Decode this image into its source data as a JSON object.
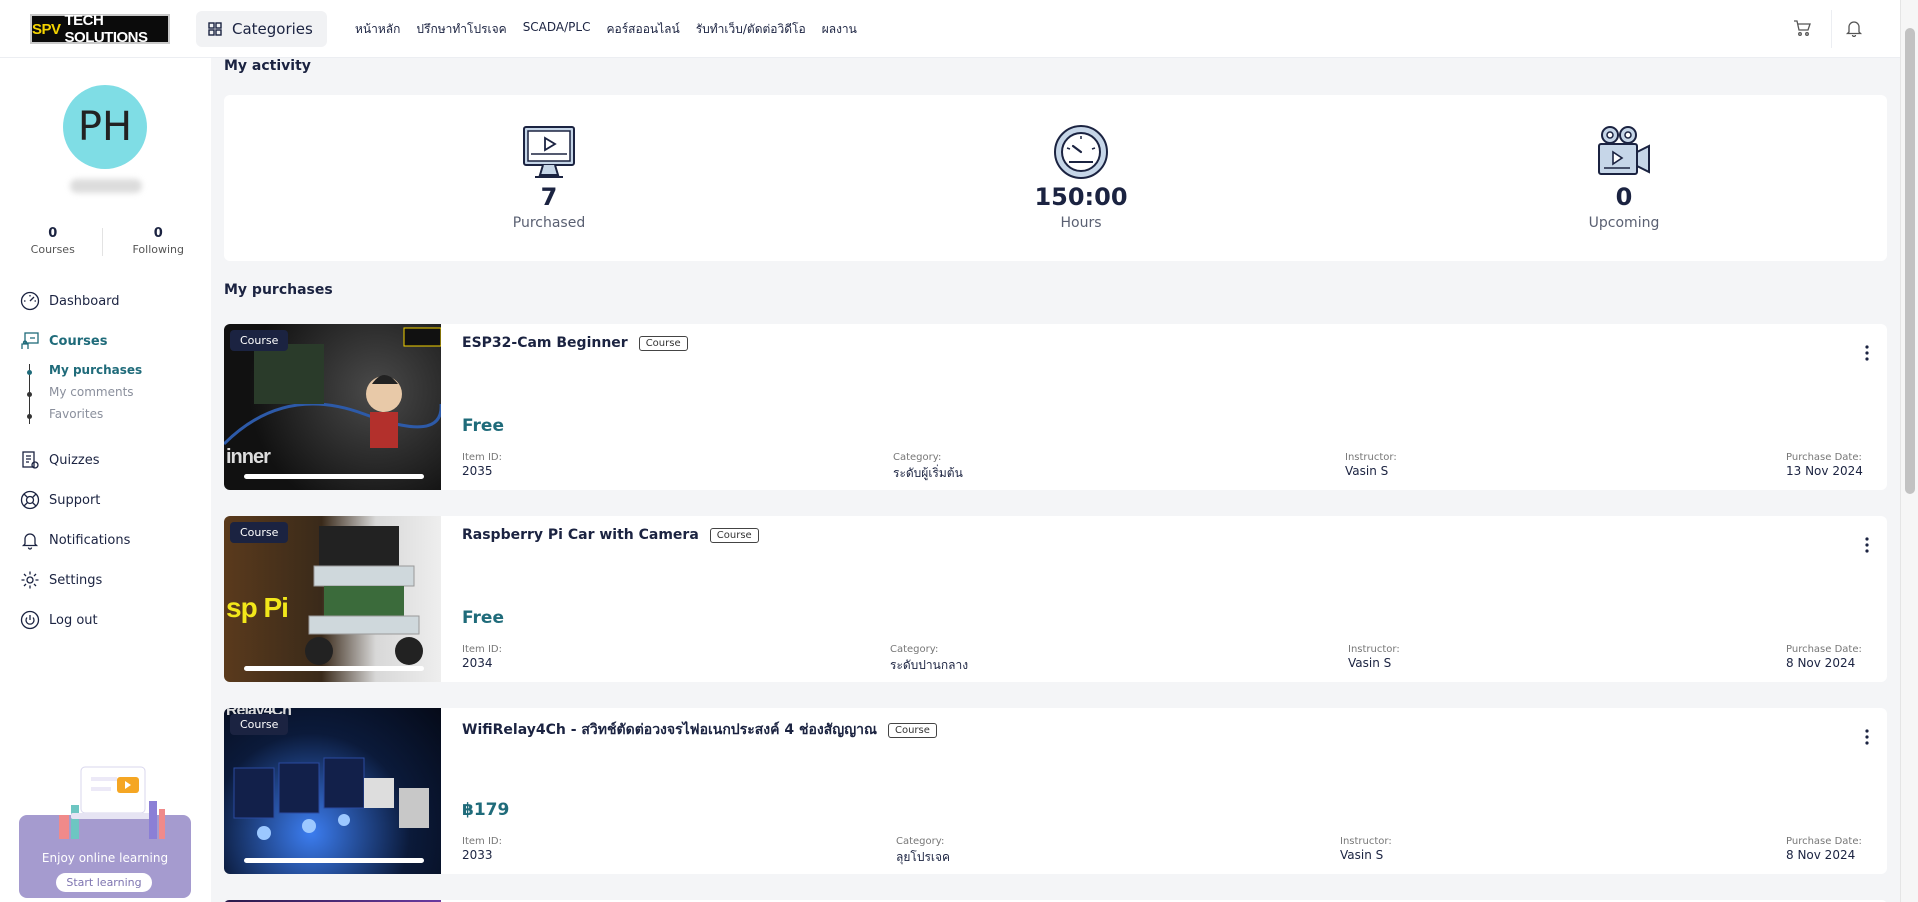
{
  "header": {
    "logo_left": "SPV",
    "logo_right": "TECH SOLUTIONS",
    "categories_label": "Categories",
    "nav": [
      "หน้าหลัก",
      "ปรึกษาทำโปรเจค",
      "SCADA/PLC",
      "คอร์สออนไลน์",
      "รับทำเว็บ/ตัดต่อวิดีโอ",
      "ผลงาน"
    ],
    "cart_icon": "cart-icon",
    "bell_icon": "bell-icon"
  },
  "profile": {
    "initials": "PH",
    "courses_count": "0",
    "courses_label": "Courses",
    "following_count": "0",
    "following_label": "Following"
  },
  "sidebar": {
    "items": [
      {
        "label": "Dashboard",
        "icon": "dashboard-icon"
      },
      {
        "label": "Courses",
        "icon": "courses-icon"
      },
      {
        "label": "Quizzes",
        "icon": "quiz-icon"
      },
      {
        "label": "Support",
        "icon": "support-icon"
      },
      {
        "label": "Notifications",
        "icon": "bell-icon"
      },
      {
        "label": "Settings",
        "icon": "gear-icon"
      },
      {
        "label": "Log out",
        "icon": "power-icon"
      }
    ],
    "sub_items": [
      "My purchases",
      "My comments",
      "Favorites"
    ],
    "promo_text": "Enjoy online learning",
    "promo_button": "Start learning"
  },
  "activity": {
    "title": "My activity",
    "items": [
      {
        "value": "7",
        "label": "Purchased",
        "icon": "monitor-icon"
      },
      {
        "value": "150:00",
        "label": "Hours",
        "icon": "gauge-icon"
      },
      {
        "value": "0",
        "label": "Upcoming",
        "icon": "video-camera-icon"
      }
    ]
  },
  "purchases": {
    "title": "My purchases",
    "thumb_badge": "Course",
    "type_badge": "Course",
    "label_item_id": "Item ID:",
    "label_category": "Category:",
    "label_instructor": "Instructor:",
    "label_date": "Purchase Date:",
    "items": [
      {
        "title": "ESP32-Cam Beginner",
        "price": "Free",
        "item_id": "2035",
        "category": "ระดับผู้เริ่มต้น",
        "instructor": "Vasin S",
        "date": "13 Nov 2024",
        "thumb_text": "inner"
      },
      {
        "title": "Raspberry Pi Car with Camera",
        "price": "Free",
        "item_id": "2034",
        "category": "ระดับปานกลาง",
        "instructor": "Vasin S",
        "date": "8 Nov 2024",
        "thumb_text": "sp Pi"
      },
      {
        "title": "WifiRelay4Ch - สวิทช์ตัดต่อวงจรไฟอเนกประสงค์ 4 ช่องสัญญาณ",
        "price": "฿179",
        "item_id": "2033",
        "category": "ลุยโปรเจค",
        "instructor": "Vasin S",
        "date": "8 Nov 2024",
        "thumb_text": "Relay4Ch"
      }
    ]
  },
  "colors": {
    "accent": "#1f6b7a",
    "dark": "#1b2341",
    "avatar": "#7fdde5",
    "promo": "#a59bcf"
  }
}
